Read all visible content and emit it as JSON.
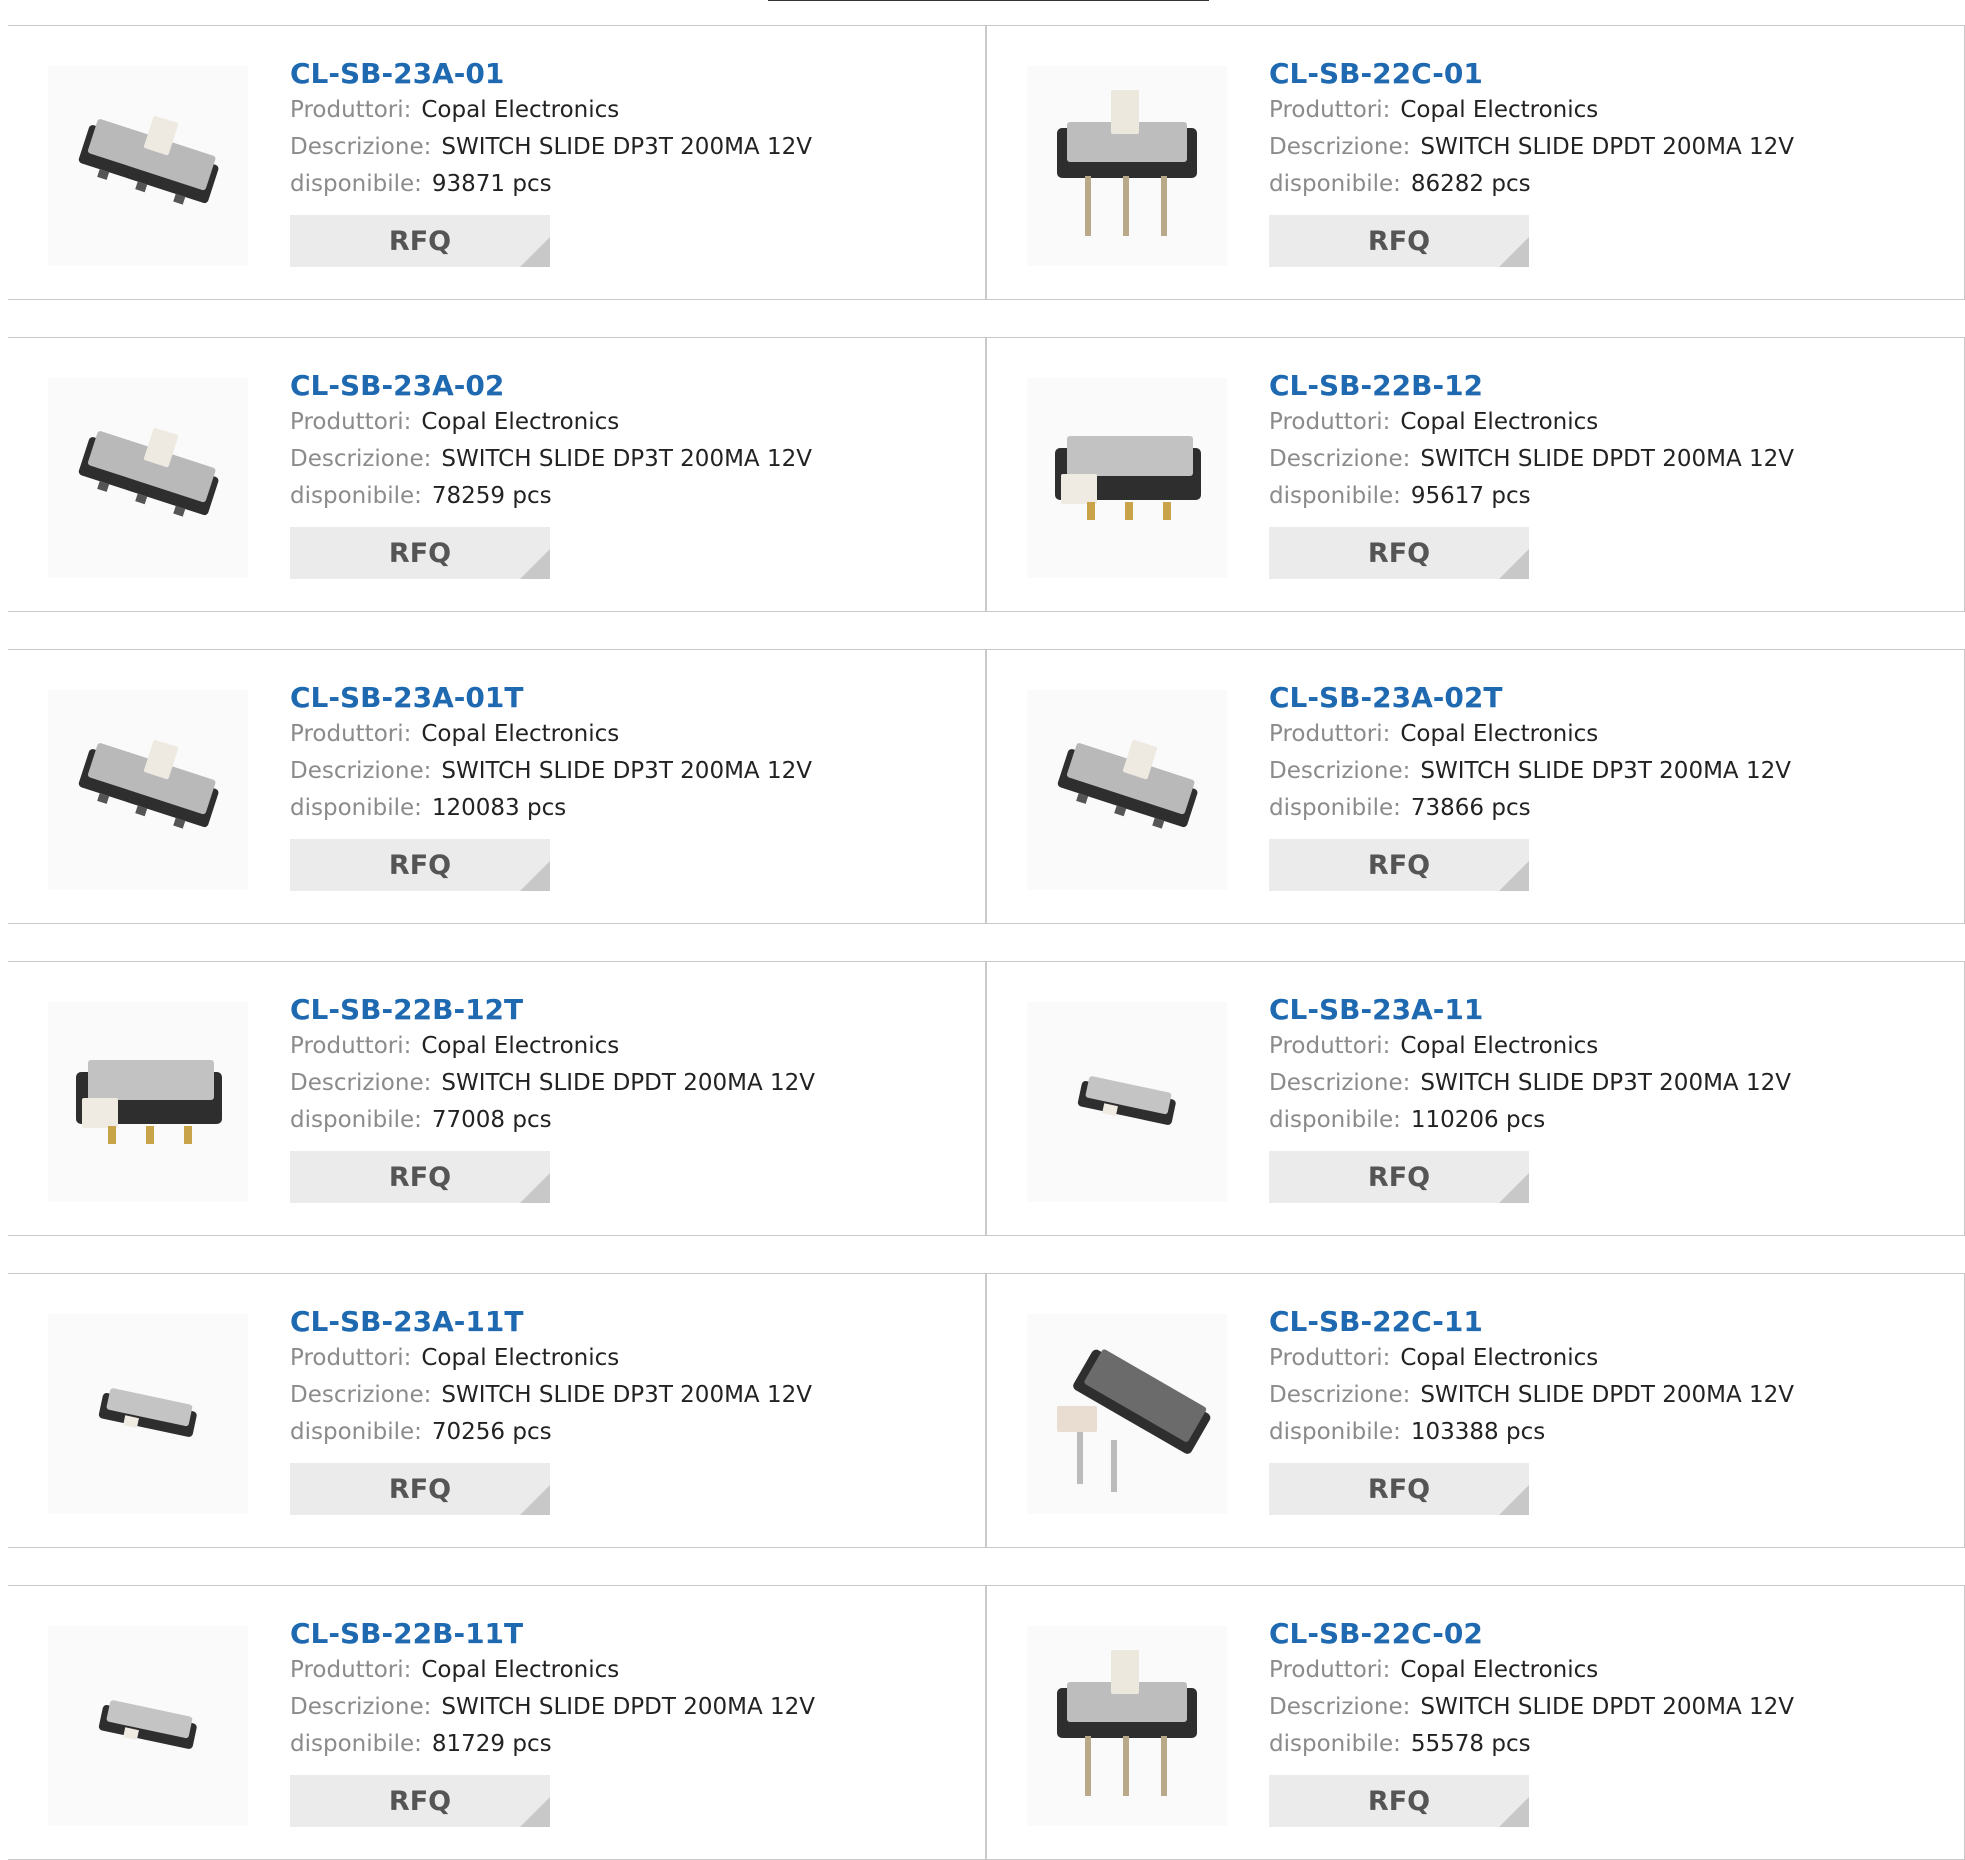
{
  "labels": {
    "manufacturer": "Produttori:",
    "description": "Descrizione:",
    "available": "disponibile:",
    "rfq": "RFQ"
  },
  "products": [
    {
      "name": "CL-SB-23A-01",
      "manufacturer": "Copal Electronics",
      "description": "SWITCH SLIDE DP3T 200MA 12V",
      "available": "93871 pcs",
      "image": "slide-switch-image"
    },
    {
      "name": "CL-SB-22C-01",
      "manufacturer": "Copal Electronics",
      "description": "SWITCH SLIDE DPDT 200MA 12V",
      "available": "86282 pcs",
      "image": "slide-switch-through-hole-image"
    },
    {
      "name": "CL-SB-23A-02",
      "manufacturer": "Copal Electronics",
      "description": "SWITCH SLIDE DP3T 200MA 12V",
      "available": "78259 pcs",
      "image": "slide-switch-image"
    },
    {
      "name": "CL-SB-22B-12",
      "manufacturer": "Copal Electronics",
      "description": "SWITCH SLIDE DPDT 200MA 12V",
      "available": "95617 pcs",
      "image": "slide-switch-side-actuator-image"
    },
    {
      "name": "CL-SB-23A-01T",
      "manufacturer": "Copal Electronics",
      "description": "SWITCH SLIDE DP3T 200MA 12V",
      "available": "120083 pcs",
      "image": "slide-switch-image"
    },
    {
      "name": "CL-SB-23A-02T",
      "manufacturer": "Copal Electronics",
      "description": "SWITCH SLIDE DP3T 200MA 12V",
      "available": "73866 pcs",
      "image": "slide-switch-image"
    },
    {
      "name": "CL-SB-22B-12T",
      "manufacturer": "Copal Electronics",
      "description": "SWITCH SLIDE DPDT 200MA 12V",
      "available": "77008 pcs",
      "image": "slide-switch-side-actuator-image"
    },
    {
      "name": "CL-SB-23A-11",
      "manufacturer": "Copal Electronics",
      "description": "SWITCH SLIDE DP3T 200MA 12V",
      "available": "110206 pcs",
      "image": "slide-switch-small-image"
    },
    {
      "name": "CL-SB-23A-11T",
      "manufacturer": "Copal Electronics",
      "description": "SWITCH SLIDE DP3T 200MA 12V",
      "available": "70256 pcs",
      "image": "slide-switch-small-image"
    },
    {
      "name": "CL-SB-22C-11",
      "manufacturer": "Copal Electronics",
      "description": "SWITCH SLIDE DPDT 200MA 12V",
      "available": "103388 pcs",
      "image": "slide-switch-right-angle-image"
    },
    {
      "name": "CL-SB-22B-11T",
      "manufacturer": "Copal Electronics",
      "description": "SWITCH SLIDE DPDT 200MA 12V",
      "available": "81729 pcs",
      "image": "slide-switch-small-image"
    },
    {
      "name": "CL-SB-22C-02",
      "manufacturer": "Copal Electronics",
      "description": "SWITCH SLIDE DPDT 200MA 12V",
      "available": "55578 pcs",
      "image": "slide-switch-through-hole-image"
    }
  ]
}
